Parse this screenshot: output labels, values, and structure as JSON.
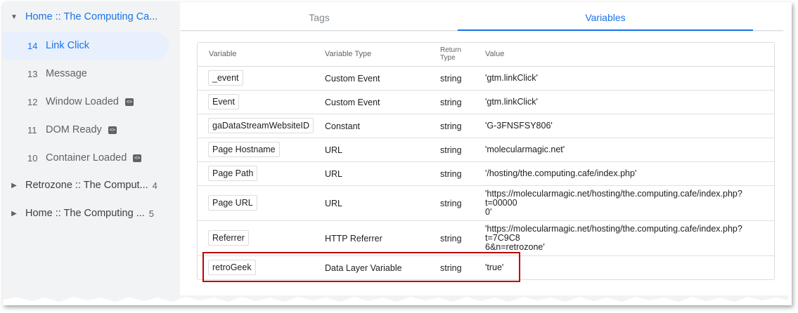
{
  "sidebar": {
    "containers": [
      {
        "caret": "▼",
        "title": "Home :: The Computing Ca...",
        "count": ""
      },
      {
        "caret": "▶",
        "title": "Retrozone :: The Comput...",
        "count": "4"
      },
      {
        "caret": "▶",
        "title": "Home :: The Computing ...",
        "count": "5"
      }
    ],
    "events": [
      {
        "num": "14",
        "name": "Link Click",
        "badge": ""
      },
      {
        "num": "13",
        "name": "Message",
        "badge": ""
      },
      {
        "num": "12",
        "name": "Window Loaded",
        "badge": "<>"
      },
      {
        "num": "11",
        "name": "DOM Ready",
        "badge": "<>"
      },
      {
        "num": "10",
        "name": "Container Loaded",
        "badge": "<>"
      }
    ]
  },
  "tabs": [
    {
      "label": "Tags"
    },
    {
      "label": "Variables"
    }
  ],
  "table": {
    "headers": {
      "variable": "Variable",
      "type": "Variable Type",
      "return_line1": "Return",
      "return_line2": "Type",
      "value": "Value"
    },
    "rows": [
      {
        "name": "_event",
        "type": "Custom Event",
        "ret": "string",
        "value": "'gtm.linkClick'"
      },
      {
        "name": "Event",
        "type": "Custom Event",
        "ret": "string",
        "value": "'gtm.linkClick'"
      },
      {
        "name": "gaDataStreamWebsiteID",
        "type": "Constant",
        "ret": "string",
        "value": "'G-3FNSFSY806'"
      },
      {
        "name": "Page Hostname",
        "type": "URL",
        "ret": "string",
        "value": "'molecularmagic.net'"
      },
      {
        "name": "Page Path",
        "type": "URL",
        "ret": "string",
        "value": "'/hosting/the.computing.cafe/index.php'"
      },
      {
        "name": "Page URL",
        "type": "URL",
        "ret": "string",
        "value": "'https://molecularmagic.net/hosting/the.computing.cafe/index.php?\nt=00000\n0'"
      },
      {
        "name": "Referrer",
        "type": "HTTP Referrer",
        "ret": "string",
        "value": "'https://molecularmagic.net/hosting/the.computing.cafe/index.php?\nt=7C9C8\n6&n=retrozone'"
      },
      {
        "name": "retroGeek",
        "type": "Data Layer Variable",
        "ret": "string",
        "value": "'true'"
      }
    ]
  },
  "colors": {
    "accent": "#1a73e8",
    "highlight": "#c00000",
    "sidebar_bg": "#f1f3f4"
  }
}
